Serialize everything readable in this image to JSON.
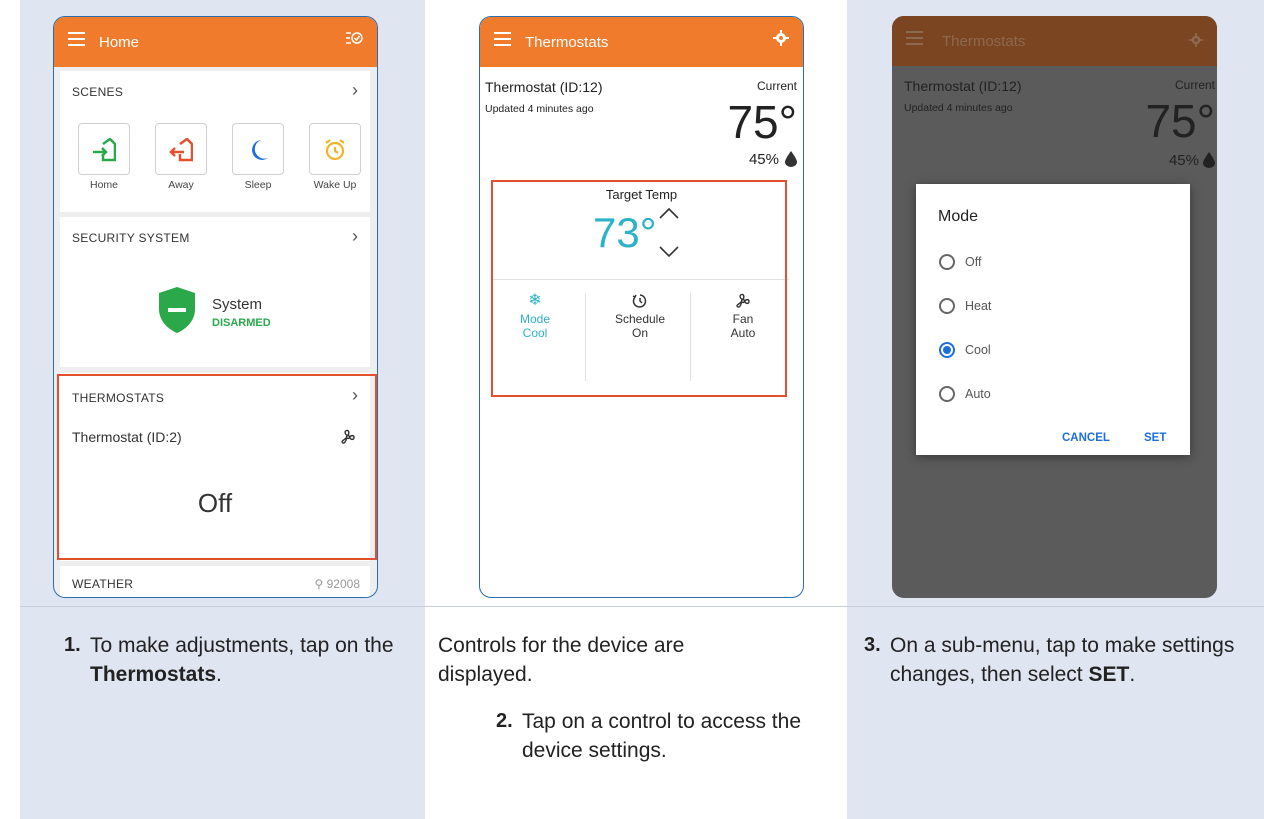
{
  "colors": {
    "accent": "#f07b2c",
    "highlight": "#e2502e",
    "teal": "#2bb3c7",
    "green": "#2aa84a",
    "radio_blue": "#1e6fd9"
  },
  "phone1": {
    "title": "Home",
    "scenes": {
      "header": "SCENES",
      "items": [
        {
          "label": "Home",
          "icon": "home-enter-icon"
        },
        {
          "label": "Away",
          "icon": "home-exit-icon"
        },
        {
          "label": "Sleep",
          "icon": "moon-icon"
        },
        {
          "label": "Wake Up",
          "icon": "alarm-clock-icon"
        }
      ]
    },
    "security": {
      "header": "SECURITY SYSTEM",
      "system_label": "System",
      "status": "DISARMED"
    },
    "thermostats": {
      "header": "THERMOSTATS",
      "device": "Thermostat (ID:2)",
      "state": "Off"
    },
    "weather": {
      "header": "WEATHER",
      "zip": "92008"
    }
  },
  "phone2": {
    "title": "Thermostats",
    "device": "Thermostat (ID:12)",
    "updated": "Updated 4 minutes ago",
    "current_label": "Current",
    "current_temp": "75°",
    "humidity": "45%",
    "target_label": "Target Temp",
    "target_temp": "73°",
    "controls": [
      {
        "label": "Mode",
        "value": "Cool",
        "icon": "snowflake-icon"
      },
      {
        "label": "Schedule",
        "value": "On",
        "icon": "schedule-icon"
      },
      {
        "label": "Fan",
        "value": "Auto",
        "icon": "fan-icon"
      }
    ]
  },
  "phone3": {
    "title": "Thermostats",
    "device": "Thermostat (ID:12)",
    "updated": "Updated 4 minutes ago",
    "current_label": "Current",
    "current_temp": "75°",
    "humidity": "45%",
    "dialog": {
      "title": "Mode",
      "options": [
        "Off",
        "Heat",
        "Cool",
        "Auto"
      ],
      "selected": "Cool",
      "cancel": "CANCEL",
      "set": "SET"
    }
  },
  "steps": {
    "s1_num": "1.",
    "s1_pre": "To make adjustments, tap on the ",
    "s1_bold": "Thermostats",
    "s1_post": ".",
    "s2_intro": "Controls for the device are displayed.",
    "s2_num": "2.",
    "s2_text": "Tap on a control to access the device settings.",
    "s3_num": "3.",
    "s3_pre": "On a sub-menu, tap to make settings changes, then select ",
    "s3_bold": "SET",
    "s3_post": "."
  }
}
